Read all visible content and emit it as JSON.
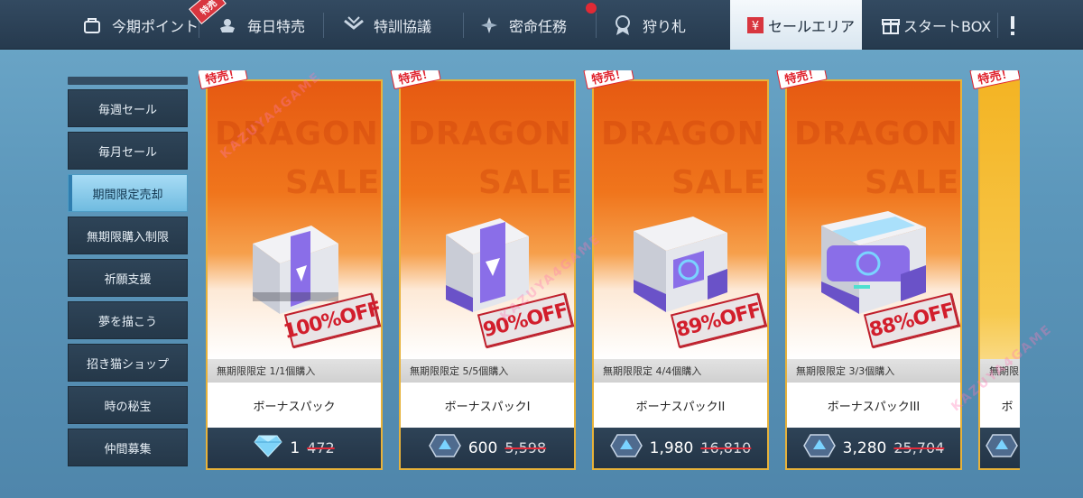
{
  "topbar": {
    "tabs": [
      {
        "label": "今期ポイント",
        "icon": "bag-icon"
      },
      {
        "label": "毎日特売",
        "icon": "flower-icon"
      },
      {
        "label": "特訓協議",
        "icon": "rank-icon"
      },
      {
        "label": "密命任務",
        "icon": "compass-icon"
      },
      {
        "label": "狩り札",
        "icon": "medal-icon"
      },
      {
        "label": "セールエリア",
        "icon": "sale-icon",
        "active": true
      },
      {
        "label": "スタートBOX",
        "icon": "gift-icon"
      }
    ],
    "badge": "特売",
    "more_icon": "more-icon"
  },
  "sidebar": {
    "items": [
      {
        "label": "毎週セール"
      },
      {
        "label": "毎月セール"
      },
      {
        "label": "期間限定売却",
        "active": true
      },
      {
        "label": "無期限購入制限"
      },
      {
        "label": "祈願支援"
      },
      {
        "label": "夢を描こう"
      },
      {
        "label": "招き猫ショップ"
      },
      {
        "label": "時の秘宝"
      },
      {
        "label": "仲間募集"
      }
    ]
  },
  "cards": [
    {
      "ribbon": "特売！",
      "bg_line1": "DRAGON",
      "bg_line2": "SALE",
      "discount": "100%OFF",
      "limit": "無期限限定  1/1個購入",
      "name": "ボーナスパック",
      "currency_icon": "diamond-icon",
      "price": "1",
      "old_price": "472"
    },
    {
      "ribbon": "特売！",
      "bg_line1": "DRAGON",
      "bg_line2": "SALE",
      "discount": "90%OFF",
      "limit": "無期限限定  5/5個購入",
      "name": "ボーナスパックI",
      "currency_icon": "crystal-icon",
      "price": "600",
      "old_price": "5,598"
    },
    {
      "ribbon": "特売！",
      "bg_line1": "DRAGON",
      "bg_line2": "SALE",
      "discount": "89%OFF",
      "limit": "無期限限定  4/4個購入",
      "name": "ボーナスパックII",
      "currency_icon": "crystal-icon",
      "price": "1,980",
      "old_price": "16,810"
    },
    {
      "ribbon": "特売！",
      "bg_line1": "DRAGON",
      "bg_line2": "SALE",
      "discount": "88%OFF",
      "limit": "無期限限定  3/3個購入",
      "name": "ボーナスパックIII",
      "currency_icon": "crystal-icon",
      "price": "3,280",
      "old_price": "25,704"
    },
    {
      "ribbon": "特売！",
      "limit": "無期限",
      "name": "ボ",
      "currency_icon": "crystal-icon"
    }
  ],
  "watermark": "KAZUYA4GAME"
}
